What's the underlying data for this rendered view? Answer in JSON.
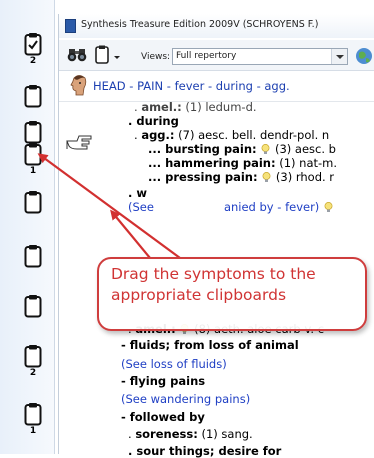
{
  "window": {
    "title": "Synthesis Treasure Edition 2009V (SCHROYENS F.)"
  },
  "toolbar": {
    "views_label": "Views:",
    "views_value": "Full repertory"
  },
  "rubric": {
    "title": "HEAD - PAIN - fever - during - agg."
  },
  "clipboards": [
    {
      "count": "2",
      "checked": true
    },
    {
      "count": ""
    },
    {
      "count": ""
    },
    {
      "count": "1"
    },
    {
      "count": ""
    },
    {
      "count": ""
    },
    {
      "count": ""
    },
    {
      "count": "2"
    },
    {
      "count": "1"
    }
  ],
  "lines": {
    "l0_pre": ". ",
    "l0_b": "amel.:",
    "l0_post": " (1) ledum-d.",
    "l1": ". during",
    "l2_pre": ". ",
    "l2_b": "agg.:",
    "l2_post": " (7) aesc. bell. dendr-pol. n",
    "l3_b": "... bursting pain:",
    "l3_post": " (3) aesc. b",
    "l4_b": "... hammering pain:",
    "l4_post": " (1) nat-m.",
    "l5_b": "... pressing pain:",
    "l5_post": " (3) rhod. r",
    "l6": ". w",
    "l7_a": "(See",
    "l7_b": "anied by - fever)",
    "l8_pre": ". ",
    "l8_b": "amel.:",
    "l8_post": " (8) aeth. aloe carb-v. c",
    "l9": "- fluids; from loss of animal",
    "l10": "(See loss of fluids)",
    "l11": "- flying pains",
    "l12": "(See wandering pains)",
    "l13": "- followed by",
    "l14_pre": ". ",
    "l14_b": "soreness:",
    "l14_post": " (1) sang.",
    "l15": ". sour things; desire for"
  },
  "callout": {
    "text": "Drag the symptoms to the appropriate clipboards"
  },
  "colors": {
    "accent_red": "#cf3d3d",
    "link_blue": "#1f3fc4",
    "rubric_blue": "#1c3fb0"
  }
}
